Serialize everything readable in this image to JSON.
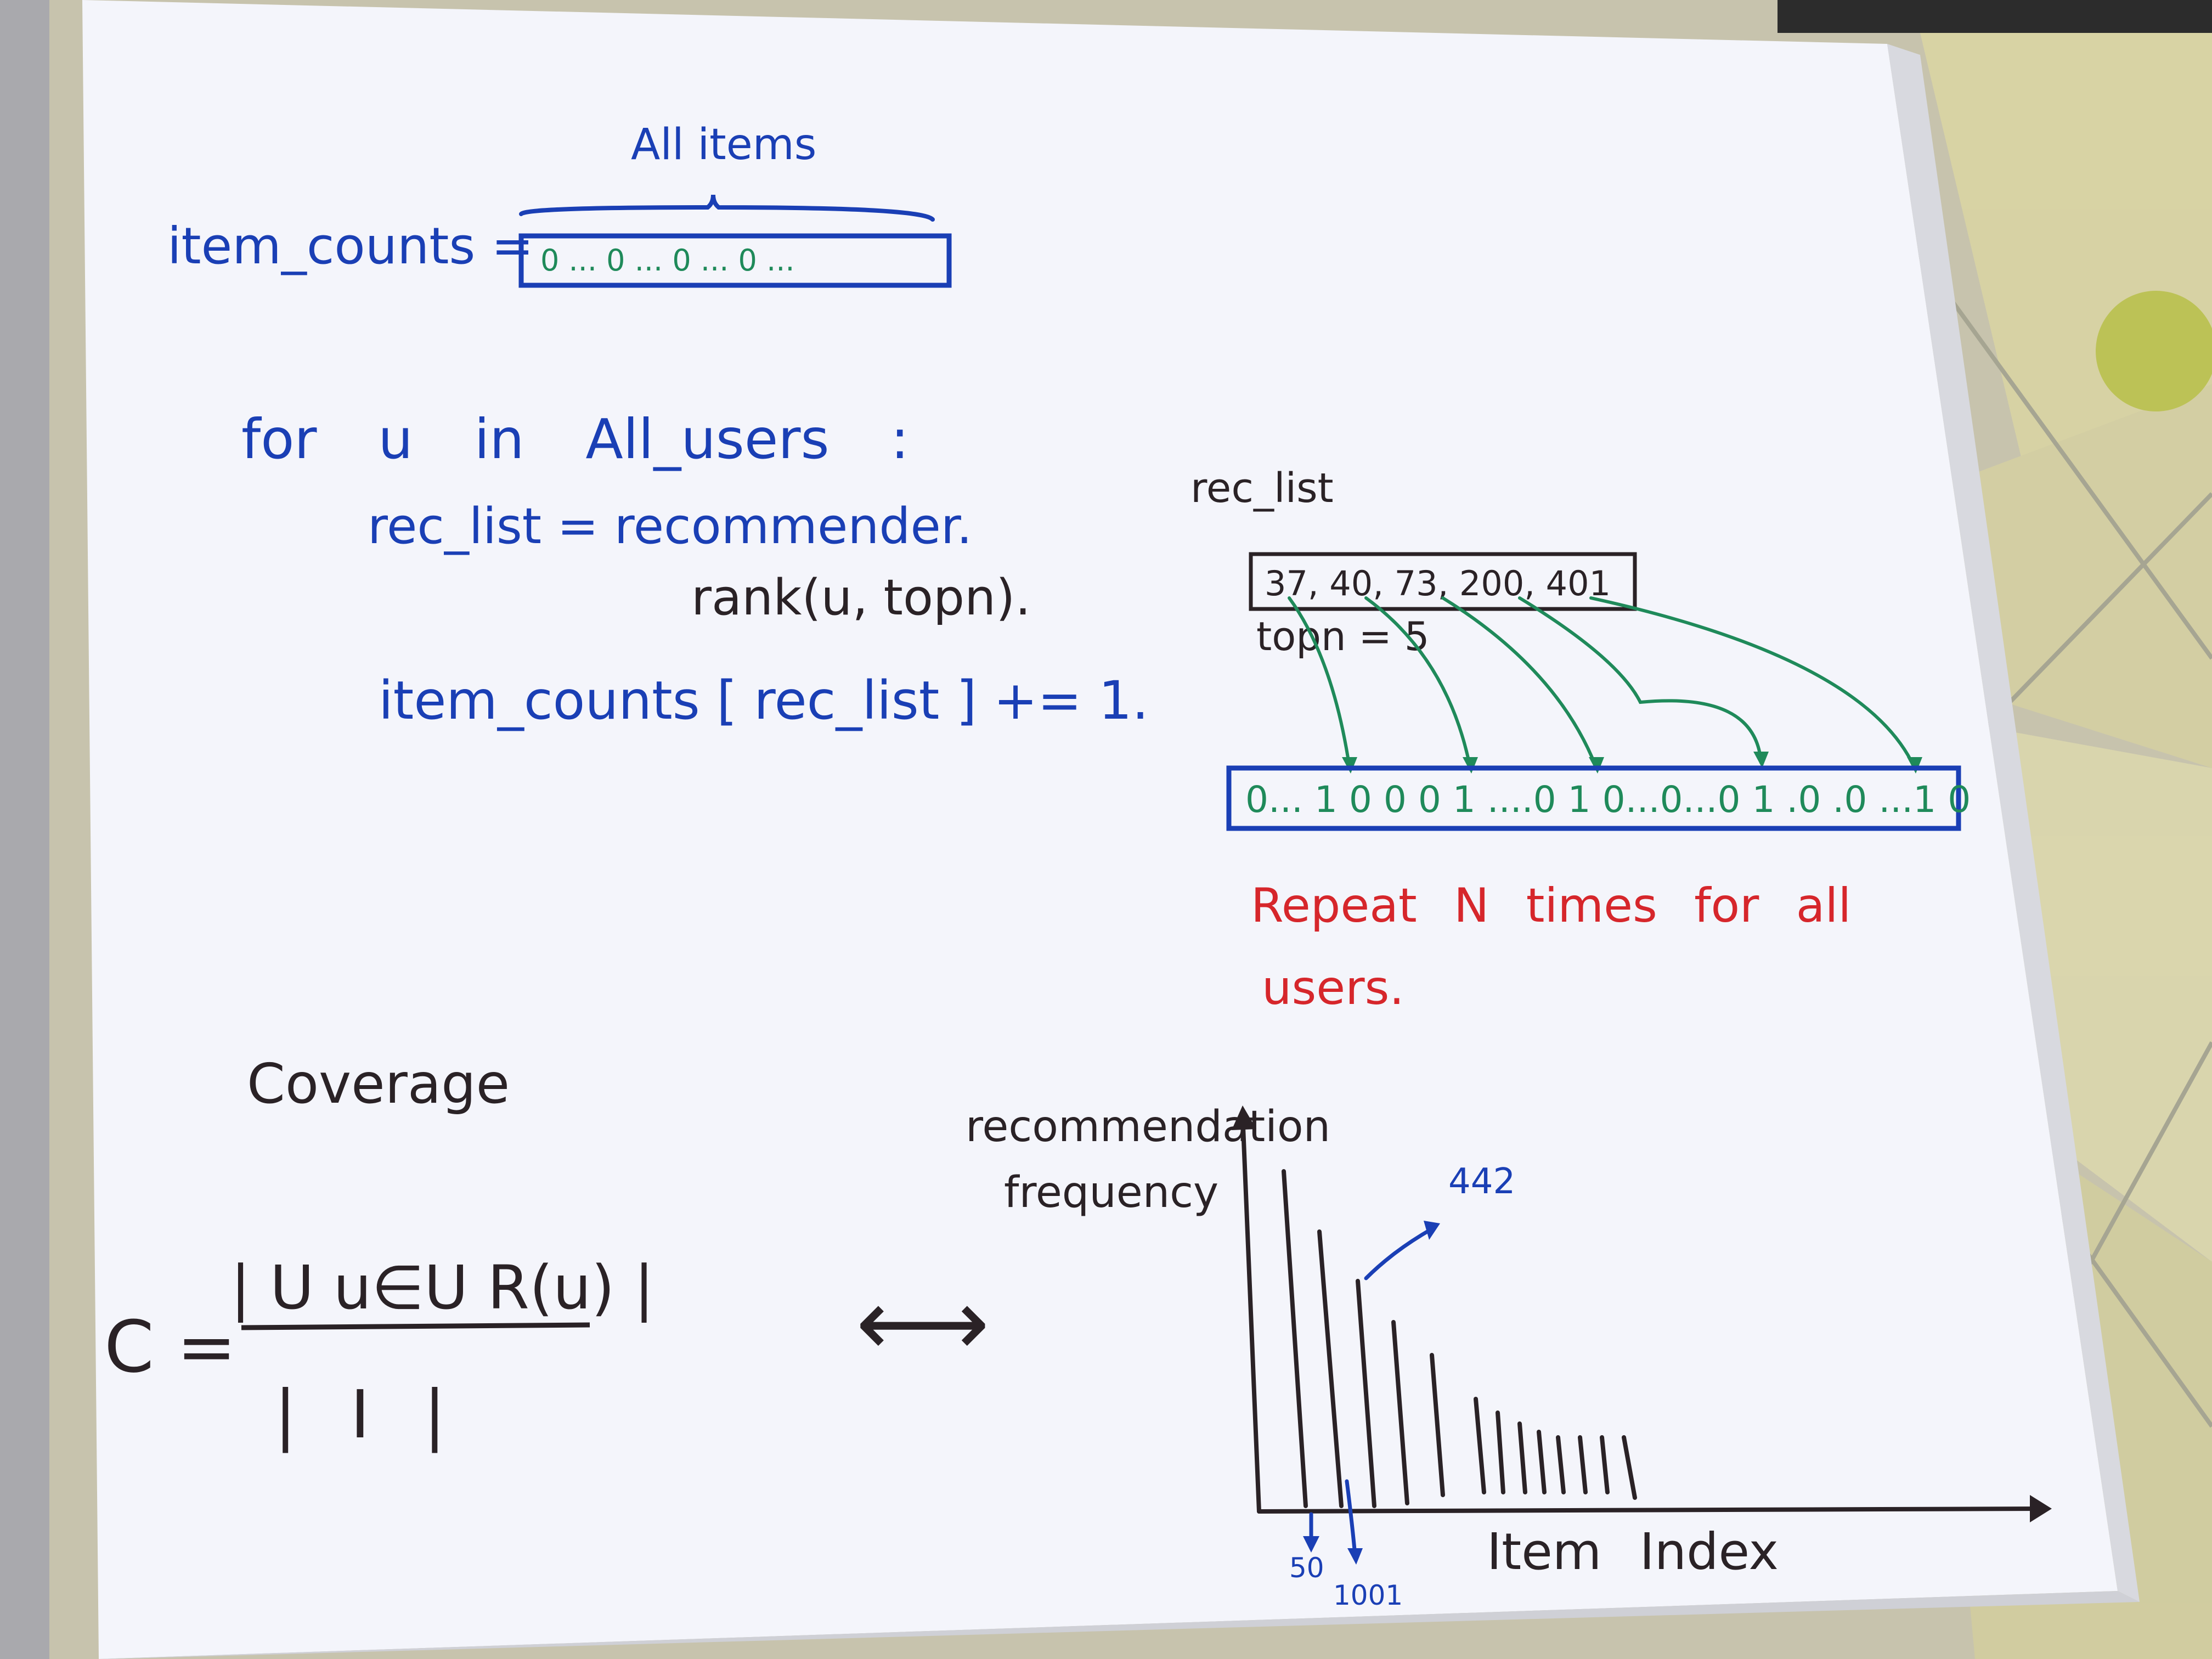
{
  "notes": {
    "all_items": "All items",
    "item_counts_init": "item_counts =",
    "zero_array": "0 ... 0 ... 0 ... 0 ...",
    "loop": "for u in All_users :",
    "rec_line_1": "rec_list = recommender.",
    "rec_line_2": "rank(u, topn).",
    "increment": "item_counts [ rec_list ] += 1.",
    "rec_list_label": "rec_list",
    "rec_values": "37, 40, 73, 200, 401",
    "topn": "topn = 5",
    "counts_array": "0... 1 0 0 0 1 ....0 1 0...0...0 1 .0 .0 ...1 0",
    "repeat_1": "Repeat N times for all",
    "repeat_2": "users.",
    "coverage": "Coverage",
    "formula_lhs": "C =",
    "numerator": "| U u∈U R(u) |",
    "denominator": "| I |",
    "equivalence": "⟷",
    "y_label_1": "recommendation",
    "y_label_2": "frequency",
    "annot_442": "442",
    "x_label": "Item Index",
    "tick_50": "50",
    "tick_1001": "1001"
  },
  "colors": {
    "paper": "#f4f5fb",
    "blue_ink": "#1a3fb5",
    "green_ink": "#1f8a5a",
    "red_ink": "#d6262b",
    "black_ink": "#2a2226",
    "table_bg": "#c9c6b4",
    "cloth_yellow": "#d9d48a",
    "flower": "#b9c23a"
  },
  "icons": {
    "arrow": "arrow-icon",
    "double_arrow": "double-arrow-icon"
  }
}
